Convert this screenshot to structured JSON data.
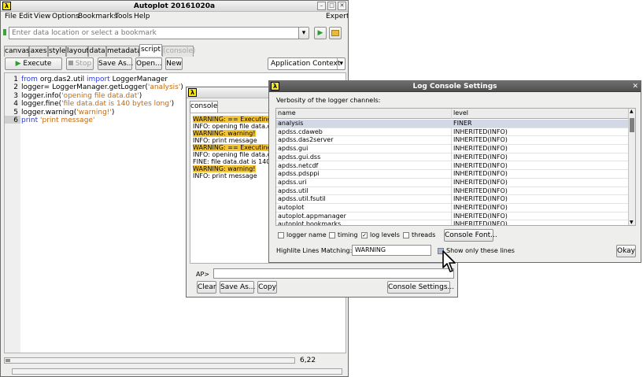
{
  "main_window": {
    "title": "Autoplot 20161020a",
    "menus": [
      "File",
      "Edit",
      "View",
      "Options",
      "Bookmarks",
      "Tools",
      "Help"
    ],
    "expert_label": "Expert",
    "address_placeholder": "Enter data location or select a bookmark",
    "tabs": [
      "canvas",
      "axes",
      "style",
      "layout",
      "data",
      "metadata",
      "script",
      "(console)"
    ],
    "active_tab": "script",
    "toolbar": {
      "execute": "Execute",
      "stop": "Stop",
      "save_as": "Save As...",
      "open": "Open...",
      "new": "New",
      "context": "Application Context"
    },
    "code_lines": [
      {
        "n": "1",
        "parts": [
          {
            "t": "from",
            "c": "kw"
          },
          {
            "t": " org.das2.util ",
            "c": ""
          },
          {
            "t": "import",
            "c": "kw"
          },
          {
            "t": " LoggerManager",
            "c": ""
          }
        ]
      },
      {
        "n": "2",
        "parts": [
          {
            "t": "logger= LoggerManager.getLogger(",
            "c": ""
          },
          {
            "t": "'analysis'",
            "c": "str"
          },
          {
            "t": ")",
            "c": ""
          }
        ]
      },
      {
        "n": "3",
        "parts": [
          {
            "t": "logger.info(",
            "c": ""
          },
          {
            "t": "'opening file data.dat'",
            "c": "str"
          },
          {
            "t": ")",
            "c": ""
          }
        ]
      },
      {
        "n": "4",
        "parts": [
          {
            "t": "logger.fine(",
            "c": ""
          },
          {
            "t": "'file data.dat is 140 bytes long'",
            "c": "str"
          },
          {
            "t": ")",
            "c": ""
          }
        ]
      },
      {
        "n": "5",
        "parts": [
          {
            "t": "logger.warning(",
            "c": ""
          },
          {
            "t": "'warning!'",
            "c": "str"
          },
          {
            "t": ")",
            "c": ""
          }
        ]
      },
      {
        "n": "6",
        "parts": [
          {
            "t": "print ",
            "c": "kw"
          },
          {
            "t": "'print message'",
            "c": "str"
          }
        ]
      }
    ],
    "cursor_position": "6,22"
  },
  "console_window": {
    "tab": "console",
    "lines": [
      {
        "text": "WARNING: == Executing S",
        "highlight": true
      },
      {
        "text": "INFO: opening file data.da",
        "highlight": false
      },
      {
        "text": "WARNING: warning!",
        "highlight": true
      },
      {
        "text": "INFO: print message",
        "highlight": false
      },
      {
        "text": "WARNING: == Executing S",
        "highlight": true
      },
      {
        "text": "INFO: opening file data.da",
        "highlight": false
      },
      {
        "text": "FINE: file data.dat is 140 b",
        "highlight": false
      },
      {
        "text": "WARNING: warning!",
        "highlight": true
      },
      {
        "text": "INFO: print message",
        "highlight": false
      }
    ],
    "prompt": "AP>",
    "buttons": {
      "clear": "Clear",
      "save_as": "Save As...",
      "copy": "Copy",
      "settings": "Console Settings..."
    }
  },
  "settings_dialog": {
    "title": "Log Console Settings",
    "verbosity_label": "Verbosity of the logger channels:",
    "columns": [
      "name",
      "level"
    ],
    "rows": [
      [
        "analysis",
        "FINER"
      ],
      [
        "apdss.cdaweb",
        "INHERITED(INFO)"
      ],
      [
        "apdss.das2server",
        "INHERITED(INFO)"
      ],
      [
        "apdss.gui",
        "INHERITED(INFO)"
      ],
      [
        "apdss.gui.dss",
        "INHERITED(INFO)"
      ],
      [
        "apdss.netcdf",
        "INHERITED(INFO)"
      ],
      [
        "apdss.pdsppi",
        "INHERITED(INFO)"
      ],
      [
        "apdss.uri",
        "INHERITED(INFO)"
      ],
      [
        "apdss.util",
        "INHERITED(INFO)"
      ],
      [
        "apdss.util.fsutil",
        "INHERITED(INFO)"
      ],
      [
        "autoplot",
        "INHERITED(INFO)"
      ],
      [
        "autoplot.appmanager",
        "INHERITED(INFO)"
      ],
      [
        "autoplot.bookmarks",
        "INHERITED(INFO)"
      ]
    ],
    "checks": {
      "logger_name": "logger name",
      "timing": "timing",
      "log_levels": "log levels",
      "threads": "threads"
    },
    "console_font": "Console Font...",
    "highlite_label": "Highlite Lines Matching:",
    "highlite_value": "WARNING",
    "show_only_label": "Show only these lines",
    "okay": "Okay"
  }
}
